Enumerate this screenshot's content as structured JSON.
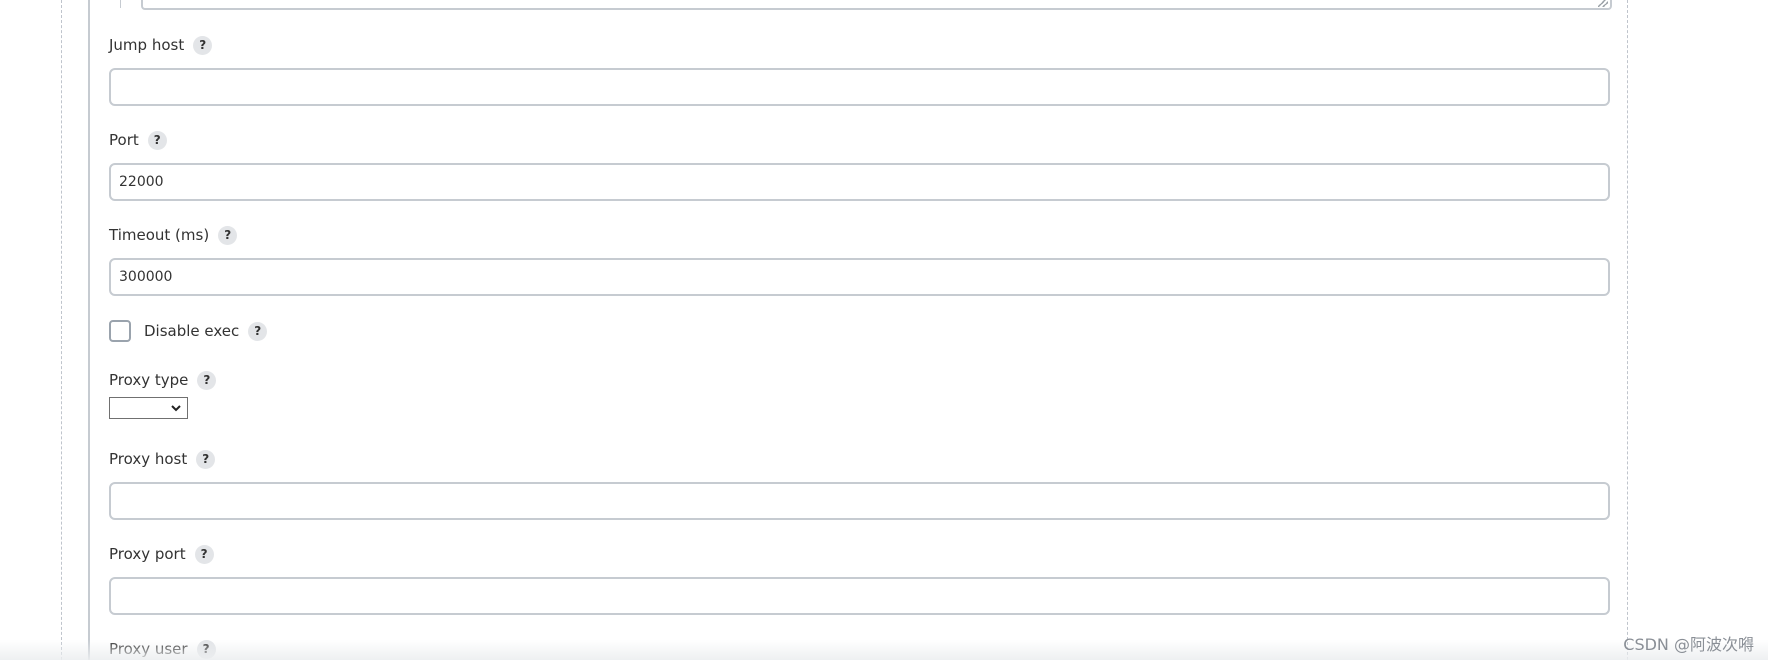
{
  "form": {
    "help_symbol": "?",
    "fields": {
      "jump_host": {
        "label": "Jump host",
        "value": ""
      },
      "port": {
        "label": "Port",
        "value": "22000"
      },
      "timeout": {
        "label": "Timeout (ms)",
        "value": "300000"
      },
      "disable_exec": {
        "label": "Disable exec",
        "checked": false
      },
      "proxy_type": {
        "label": "Proxy type",
        "value": ""
      },
      "proxy_host": {
        "label": "Proxy host",
        "value": ""
      },
      "proxy_port": {
        "label": "Proxy port",
        "value": ""
      },
      "proxy_user": {
        "label": "Proxy user"
      }
    }
  },
  "watermark": "CSDN @阿波次嘚",
  "icons": {
    "help": "help-icon",
    "dropdown": "chevron-down-icon",
    "resize": "resize-grip-icon"
  }
}
